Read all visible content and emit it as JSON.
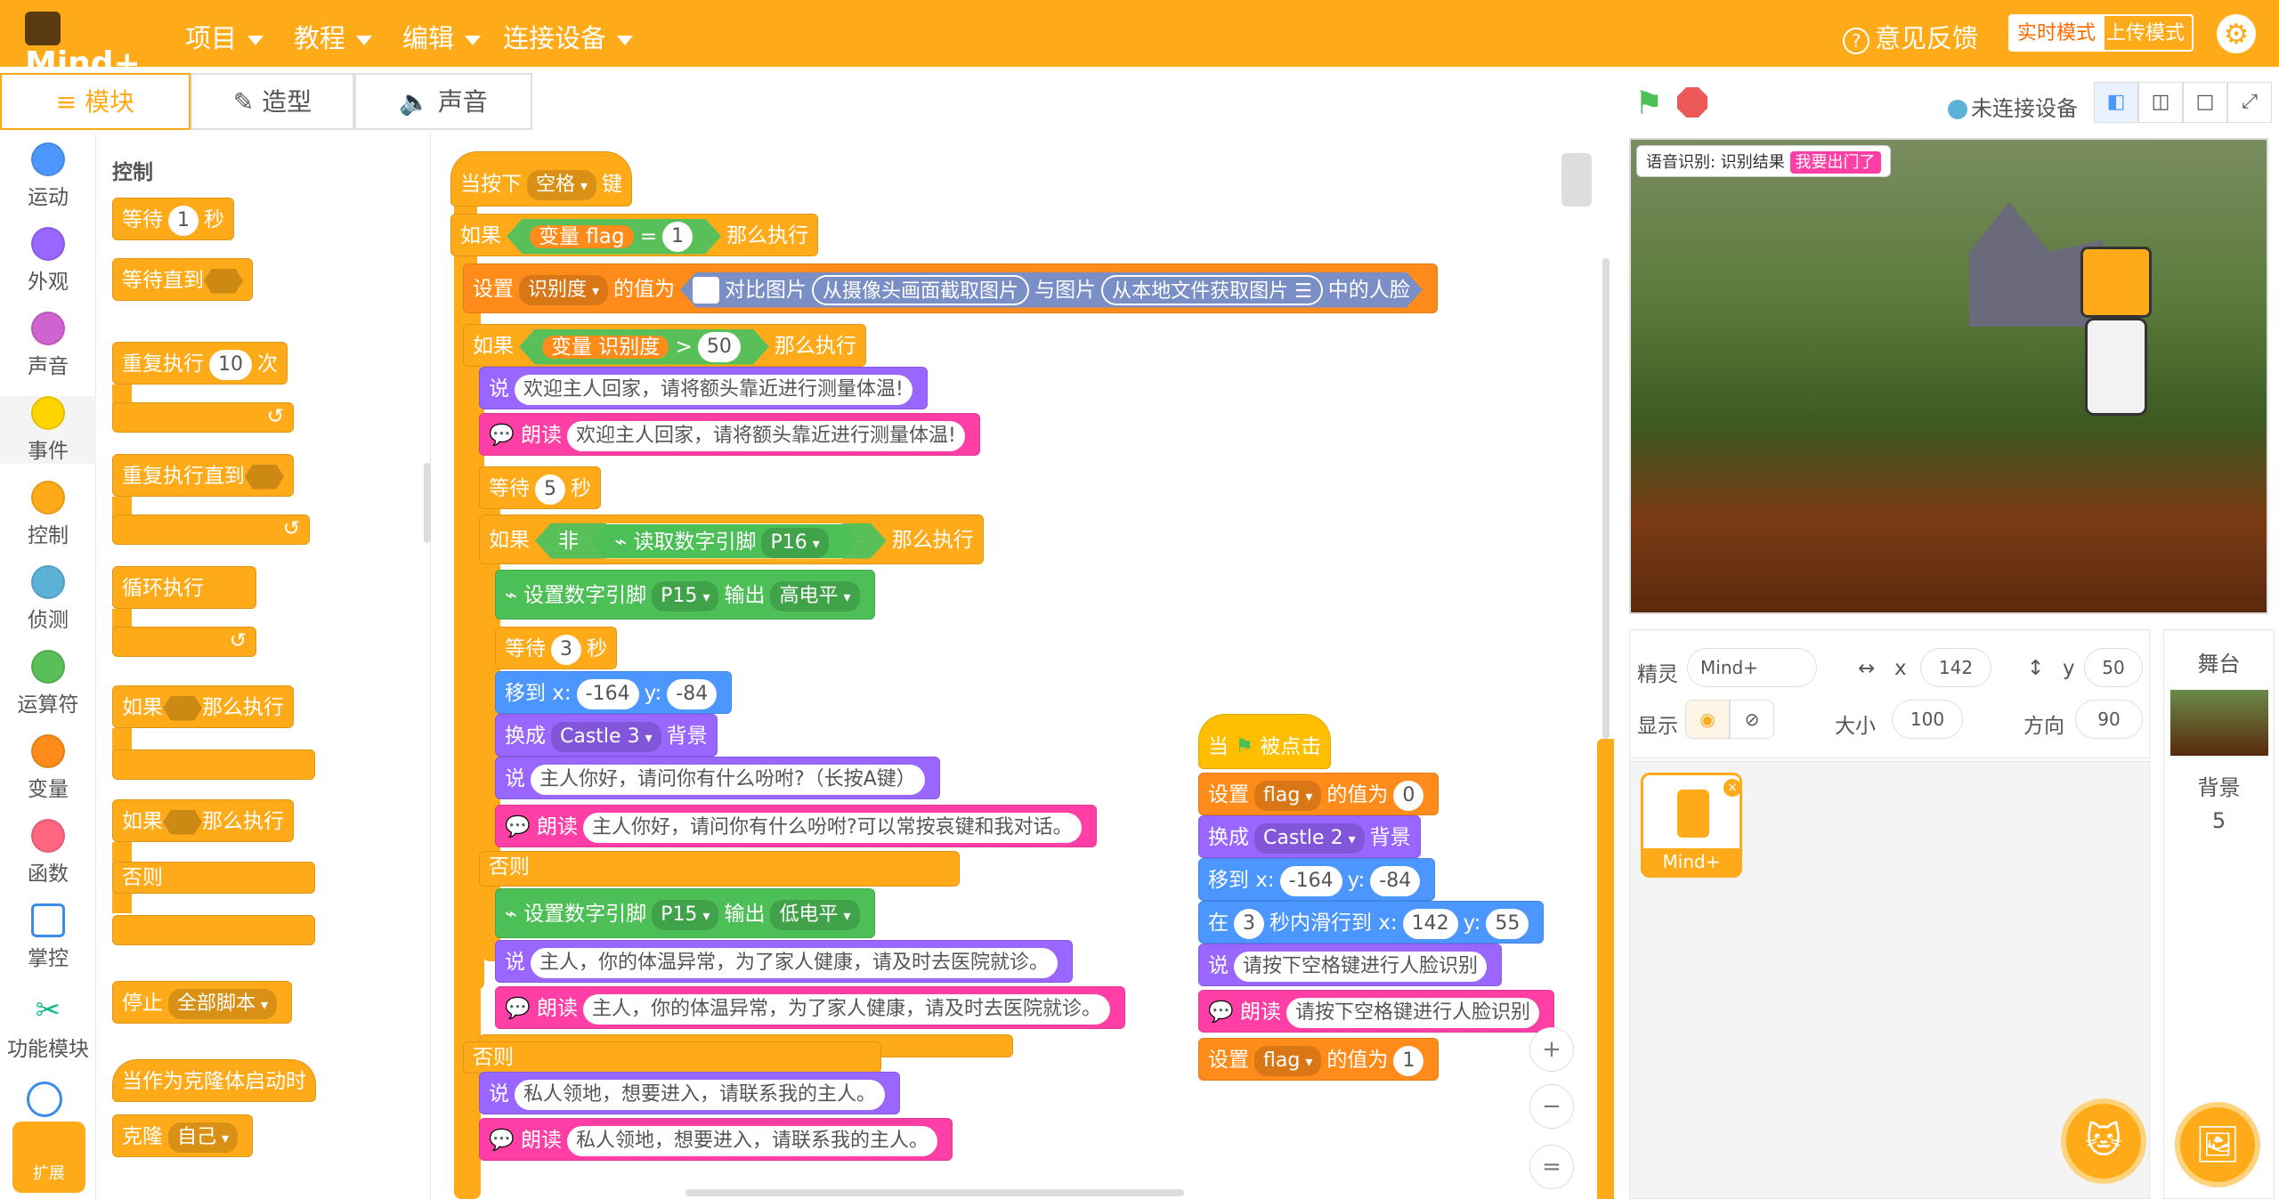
{
  "app": {
    "logo": "Mind+",
    "menus": [
      "项目",
      "教程",
      "编辑",
      "连接设备"
    ],
    "feedback": "意见反馈",
    "mode_live": "实时模式",
    "mode_upload": "上传模式"
  },
  "tabs": [
    "模块",
    "造型",
    "声音"
  ],
  "categories": [
    {
      "label": "运动",
      "color": "#4c97ff"
    },
    {
      "label": "外观",
      "color": "#9966ff"
    },
    {
      "label": "声音",
      "color": "#cf63cf"
    },
    {
      "label": "事件",
      "color": "#ffd500"
    },
    {
      "label": "控制",
      "color": "#ffab19"
    },
    {
      "label": "侦测",
      "color": "#5cb1d6"
    },
    {
      "label": "运算符",
      "color": "#59c059"
    },
    {
      "label": "变量",
      "color": "#ff8c1a"
    },
    {
      "label": "函数",
      "color": "#ff6680"
    },
    {
      "label": "掌控",
      "color": "#3b8beb"
    },
    {
      "label": "功能模块",
      "color": "#0fbd8c"
    }
  ],
  "extensions_label": "扩展",
  "palette": {
    "title": "控制",
    "wait": "等待",
    "wait_val": "1",
    "sec": "秒",
    "wait_until": "等待直到",
    "repeat": "重复执行",
    "repeat_val": "10",
    "times": "次",
    "repeat_until": "重复执行直到",
    "forever": "循环执行",
    "if_then": "如果",
    "then": "那么执行",
    "else": "否则",
    "stop": "停止",
    "stop_opt": "全部脚本",
    "clone_start": "当作为克隆体启动时",
    "clone": "克隆",
    "clone_opt": "自己"
  },
  "script1": {
    "hat": "当按下",
    "key": "空格",
    "key_suffix": "键",
    "if": "如果",
    "var_flag": "变量 flag",
    "eq": "=",
    "eq_val": "1",
    "then": "那么执行",
    "set": "设置",
    "set_var": "识别度",
    "set_mid": "的值为",
    "compare": "对比图片",
    "from_cam": "从摄像头画面截取图片",
    "and_img": "与图片",
    "from_file": "从本地文件获取图片",
    "face": "中的人脸",
    "var_rec": "变量 识别度",
    "gt": ">",
    "gt_val": "50",
    "say": "说",
    "say1": "欢迎主人回家，请将额头靠近进行测量体温!",
    "read": "朗读",
    "read1": "欢迎主人回家，请将额头靠近进行测量体温!",
    "wait": "等待",
    "wait_val": "5",
    "sec": "秒",
    "not": "非",
    "digital_read": "读取数字引脚",
    "pin16": "P16",
    "set_digital": "设置数字引脚",
    "pin15": "P15",
    "output": "输出",
    "high": "高电平",
    "low": "低电平",
    "wait2_val": "3",
    "move": "移到 x:",
    "mx": "-164",
    "my_label": "y:",
    "my": "-84",
    "switch": "换成",
    "backdrop": "Castle 3",
    "backdrop_suffix": "背景",
    "say2": "主人你好，请问你有什么吩咐?（长按A键）",
    "read2": "主人你好，请问你有什么吩咐?可以常按哀键和我对话。",
    "else": "否则",
    "say3": "主人，你的体温异常，为了家人健康，请及时去医院就诊。",
    "read3": "主人，你的体温异常，为了家人健康，请及时去医院就诊。",
    "say4": "私人领地，想要进入，请联系我的主人。",
    "read4": "私人领地，想要进入，请联系我的主人。"
  },
  "script2": {
    "hat": "当",
    "hat2": "被点击",
    "set": "设置",
    "var": "flag",
    "mid": "的值为",
    "val0": "0",
    "switch": "换成",
    "backdrop": "Castle 2",
    "backdrop_suffix": "背景",
    "move": "移到 x:",
    "mx": "-164",
    "my_label": "y:",
    "my": "-84",
    "glide": "在",
    "glide_sec": "3",
    "glide_mid": "秒内滑行到 x:",
    "gx": "142",
    "gy_label": "y:",
    "gy": "55",
    "say": "说",
    "say_text": "请按下空格键进行人脸识别",
    "read": "朗读",
    "read_text": "请按下空格键进行人脸识别",
    "val1": "1"
  },
  "stage": {
    "status": "未连接设备",
    "monitor_label": "语音识别: 识别结果",
    "monitor_value": "我要出门了"
  },
  "sprite": {
    "label_sprite": "精灵",
    "name": "Mind+",
    "x_label": "x",
    "x": "142",
    "y_label": "y",
    "y": "50",
    "show_label": "显示",
    "size_label": "大小",
    "size": "100",
    "dir_label": "方向",
    "dir": "90",
    "thumb_name": "Mind+"
  },
  "stage_panel": {
    "title": "舞台",
    "backdrop_label": "背景",
    "backdrop_count": "5"
  },
  "colors": {
    "control": "#ffab19",
    "looks": "#9966ff",
    "operators": "#59c059",
    "variables": "#ff8c1a",
    "tts": "#ff3fa5",
    "hardware": "#4cbf56"
  }
}
